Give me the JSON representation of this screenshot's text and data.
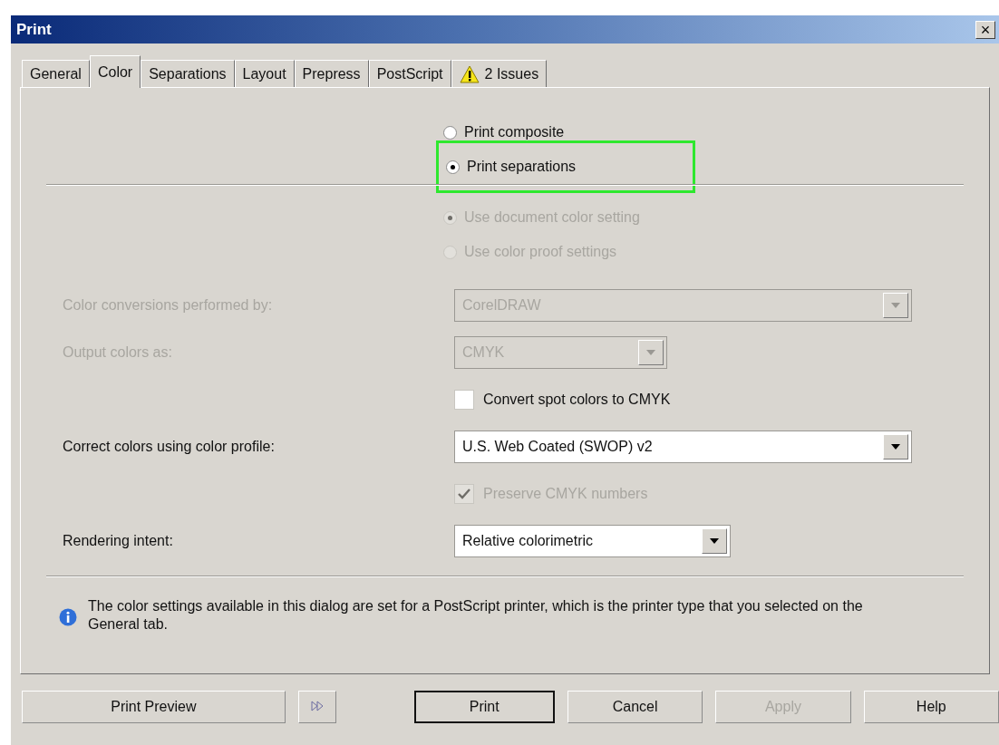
{
  "window": {
    "title": "Print",
    "close": "×"
  },
  "tabs": [
    {
      "label": "General",
      "selected": false,
      "kind": "plain"
    },
    {
      "label": "Color",
      "selected": true,
      "kind": "plain"
    },
    {
      "label": "Separations",
      "selected": false,
      "kind": "plain"
    },
    {
      "label": "Layout",
      "selected": false,
      "kind": "plain"
    },
    {
      "label": "Prepress",
      "selected": false,
      "kind": "plain"
    },
    {
      "label": "PostScript",
      "selected": false,
      "kind": "plain"
    },
    {
      "label": "2 Issues",
      "selected": false,
      "kind": "warning"
    }
  ],
  "output_mode": [
    {
      "label": "Print composite",
      "selected": false,
      "highlighted": false
    },
    {
      "label": "Print separations",
      "selected": true,
      "highlighted": true
    }
  ],
  "color_source": [
    {
      "label": "Use document color setting",
      "selected": true,
      "disabled": true
    },
    {
      "label": "Use color proof settings",
      "selected": false,
      "disabled": true
    }
  ],
  "settings": [
    {
      "kind": "select",
      "label": "Color conversions performed by:",
      "value": "CorelDRAW",
      "disabled": true
    },
    {
      "kind": "select",
      "label": "Output colors as:",
      "value": "CMYK",
      "disabled": true
    },
    {
      "kind": "checkbox",
      "label": "Convert spot colors to CMYK",
      "checked": false,
      "disabled": false
    },
    {
      "kind": "select",
      "label": "Correct colors using color profile:",
      "value": "U.S. Web Coated (SWOP) v2",
      "disabled": false
    },
    {
      "kind": "checkbox",
      "label": "Preserve CMYK numbers",
      "checked": true,
      "disabled": true
    },
    {
      "kind": "select",
      "label": "Rendering intent:",
      "value": "Relative colorimetric",
      "disabled": false
    }
  ],
  "info": "The color settings available in this dialog are set for a PostScript printer, which is the printer type that you selected on the General tab.",
  "buttons": [
    {
      "label": "Print Preview",
      "kind": "wide",
      "disabled": false
    },
    {
      "kind": "expand"
    },
    {
      "label": "Print",
      "kind": "default",
      "disabled": false
    },
    {
      "label": "Cancel",
      "kind": "normal",
      "disabled": false
    },
    {
      "label": "Apply",
      "kind": "normal",
      "disabled": true
    },
    {
      "label": "Help",
      "kind": "normal",
      "disabled": false
    }
  ]
}
